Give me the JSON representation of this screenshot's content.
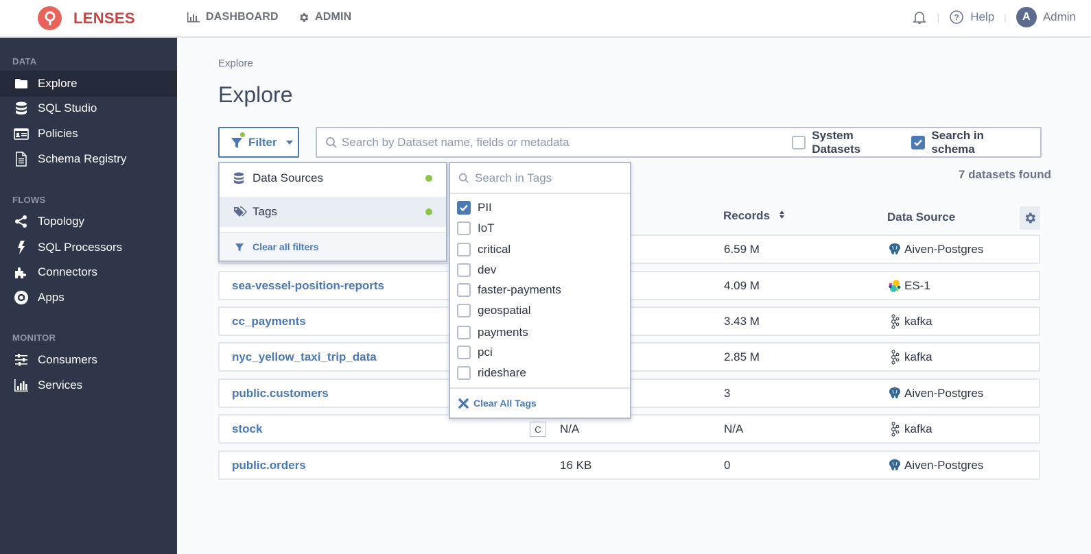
{
  "app": {
    "brand": "LENSES"
  },
  "topnav": {
    "dashboard": "DASHBOARD",
    "admin": "ADMIN",
    "help": "Help",
    "user_initial": "A",
    "user_name": "Admin"
  },
  "sidebar": {
    "sections": [
      "DATA",
      "FLOWS",
      "MONITOR"
    ],
    "data_items": [
      {
        "label": "Explore",
        "icon": "folder-icon",
        "active": true
      },
      {
        "label": "SQL Studio",
        "icon": "database-icon"
      },
      {
        "label": "Policies",
        "icon": "id-card-icon"
      },
      {
        "label": "Schema Registry",
        "icon": "document-icon"
      }
    ],
    "flows_items": [
      {
        "label": "Topology",
        "icon": "share-icon"
      },
      {
        "label": "SQL Processors",
        "icon": "bolt-icon"
      },
      {
        "label": "Connectors",
        "icon": "puzzle-icon"
      },
      {
        "label": "Apps",
        "icon": "at-icon"
      }
    ],
    "monitor_items": [
      {
        "label": "Consumers",
        "icon": "sliders-icon"
      },
      {
        "label": "Services",
        "icon": "bar-chart-icon"
      }
    ]
  },
  "page": {
    "breadcrumb": "Explore",
    "title": "Explore",
    "filter_label": "Filter",
    "search_placeholder": "Search by Dataset name, fields or metadata",
    "system_datasets_label": "System Datasets",
    "system_datasets_checked": false,
    "search_in_schema_label": "Search in schema",
    "search_in_schema_checked": true,
    "found_text": "7 datasets found"
  },
  "table": {
    "columns": {
      "records": "Records",
      "data_source": "Data Source"
    },
    "rows": [
      {
        "name": "",
        "size": "",
        "records": "6.59 M",
        "source": "Aiven-Postgres",
        "source_type": "postgres"
      },
      {
        "name": "sea-vessel-position-reports",
        "size": "",
        "records": "4.09 M",
        "source": "ES-1",
        "source_type": "elastic"
      },
      {
        "name": "cc_payments",
        "size": "",
        "records": "3.43 M",
        "source": "kafka",
        "source_type": "kafka"
      },
      {
        "name": "nyc_yellow_taxi_trip_data",
        "size": "",
        "records": "2.85 M",
        "source": "kafka",
        "source_type": "kafka"
      },
      {
        "name": "public.customers",
        "size": "",
        "records": "3",
        "source": "Aiven-Postgres",
        "source_type": "postgres"
      },
      {
        "name": "stock",
        "tag": "C",
        "size": "N/A",
        "records": "N/A",
        "source": "kafka",
        "source_type": "kafka"
      },
      {
        "name": "public.orders",
        "size": "16 KB",
        "records": "0",
        "source": "Aiven-Postgres",
        "source_type": "postgres"
      }
    ]
  },
  "filter_menu": {
    "options": [
      {
        "label": "Data Sources",
        "active_indicator": true
      },
      {
        "label": "Tags",
        "active_indicator": true,
        "selected": true
      }
    ],
    "clear_all": "Clear all filters"
  },
  "tags_menu": {
    "search_placeholder": "Search in Tags",
    "tags": [
      {
        "label": "PII",
        "checked": true
      },
      {
        "label": "IoT",
        "checked": false
      },
      {
        "label": "critical",
        "checked": false
      },
      {
        "label": "dev",
        "checked": false
      },
      {
        "label": "faster-payments",
        "checked": false
      },
      {
        "label": "geospatial",
        "checked": false
      },
      {
        "label": "payments",
        "checked": false
      },
      {
        "label": "pci",
        "checked": false
      },
      {
        "label": "rideshare",
        "checked": false
      }
    ],
    "clear_all": "Clear All Tags"
  },
  "colors": {
    "accent": "#4b79b4",
    "brand": "#c84343",
    "sidebar_bg": "#2f3649",
    "active_dot": "#8bc34a"
  }
}
